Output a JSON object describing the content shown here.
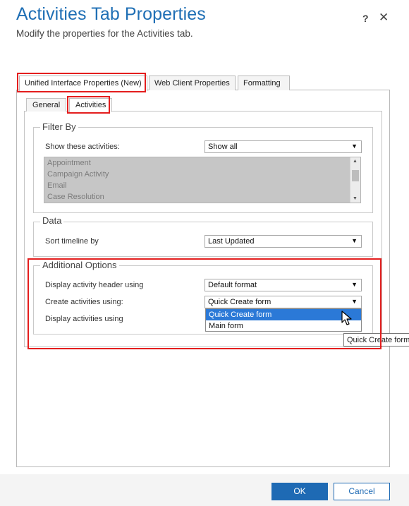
{
  "dialog": {
    "title": "Activities Tab Properties",
    "subtitle": "Modify the properties for the Activities tab.",
    "help_label": "?",
    "close_label": "✕"
  },
  "outer_tabs": [
    {
      "label": "Unified Interface Properties (New)",
      "active": true
    },
    {
      "label": "Web Client Properties",
      "active": false
    },
    {
      "label": "Formatting",
      "active": false
    }
  ],
  "inner_tabs": [
    {
      "label": "General",
      "active": false
    },
    {
      "label": "Activities",
      "active": true
    }
  ],
  "filter_by": {
    "legend": "Filter By",
    "show_label": "Show these activities:",
    "show_value": "Show all",
    "activities": [
      "Appointment",
      "Campaign Activity",
      "Email",
      "Case Resolution"
    ]
  },
  "data_section": {
    "legend": "Data",
    "sort_label": "Sort timeline by",
    "sort_value": "Last Updated"
  },
  "additional": {
    "legend": "Additional Options",
    "header_label": "Display activity header using",
    "header_value": "Default format",
    "create_label": "Create activities using:",
    "create_value": "Quick Create form",
    "display_label": "Display activities using",
    "create_options": [
      "Quick Create form",
      "Main form"
    ],
    "selected_option_index": 0
  },
  "tooltip": "Quick Create form",
  "footer": {
    "ok_label": "OK",
    "cancel_label": "Cancel"
  },
  "colors": {
    "title": "#1f6fb5",
    "highlight": "#e41e1e",
    "selected_option": "#2b79d7",
    "ok_button": "#1e6ab4"
  }
}
